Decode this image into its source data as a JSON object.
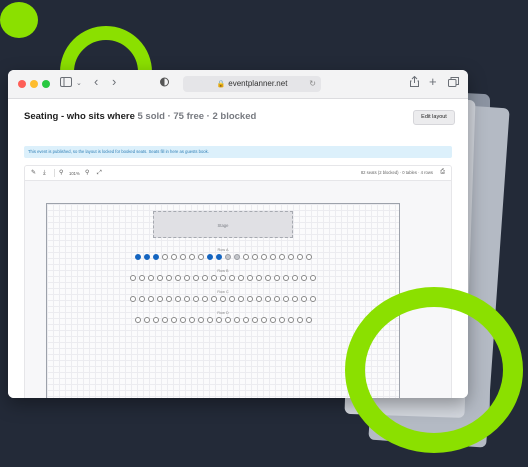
{
  "browser": {
    "url": "eventplanner.net",
    "lock_icon": "lock-icon",
    "reload_icon": "reload-icon"
  },
  "page": {
    "title": "Seating - who sits where",
    "summary": "5 sold · 75 free · 2 blocked",
    "edit_button": "Edit layout",
    "notice": "This event is published, so the layout is locked for booked seats. Seats fill in here as guests book."
  },
  "toolbar": {
    "zoom": "101%",
    "summary": "82 seats (2 blocked) · 0 tables · 4 rows",
    "icons": [
      "pencil-icon",
      "download-icon",
      "zoom-out-icon",
      "zoom-in-icon",
      "fit-screen-icon",
      "print-icon"
    ]
  },
  "layout": {
    "stage_label": "Stage",
    "rows": [
      {
        "label": "Row A",
        "seats": [
          "sold",
          "sold",
          "sold",
          "free",
          "free",
          "free",
          "free",
          "free",
          "sold",
          "sold",
          "blocked",
          "blocked",
          "free",
          "free",
          "free",
          "free",
          "free",
          "free",
          "free",
          "free"
        ]
      },
      {
        "label": "Row B",
        "seats": [
          "free",
          "free",
          "free",
          "free",
          "free",
          "free",
          "free",
          "free",
          "free",
          "free",
          "free",
          "free",
          "free",
          "free",
          "free",
          "free",
          "free",
          "free",
          "free",
          "free",
          "free"
        ]
      },
      {
        "label": "Row C",
        "seats": [
          "free",
          "free",
          "free",
          "free",
          "free",
          "free",
          "free",
          "free",
          "free",
          "free",
          "free",
          "free",
          "free",
          "free",
          "free",
          "free",
          "free",
          "free",
          "free",
          "free",
          "free"
        ]
      },
      {
        "label": "Row D",
        "seats": [
          "free",
          "free",
          "free",
          "free",
          "free",
          "free",
          "free",
          "free",
          "free",
          "free",
          "free",
          "free",
          "free",
          "free",
          "free",
          "free",
          "free",
          "free",
          "free",
          "free"
        ]
      }
    ]
  },
  "colors": {
    "accent_green": "#8be000",
    "sold_seat": "#1565c0",
    "blocked_seat": "#c4c6cb",
    "background": "#232a38"
  }
}
